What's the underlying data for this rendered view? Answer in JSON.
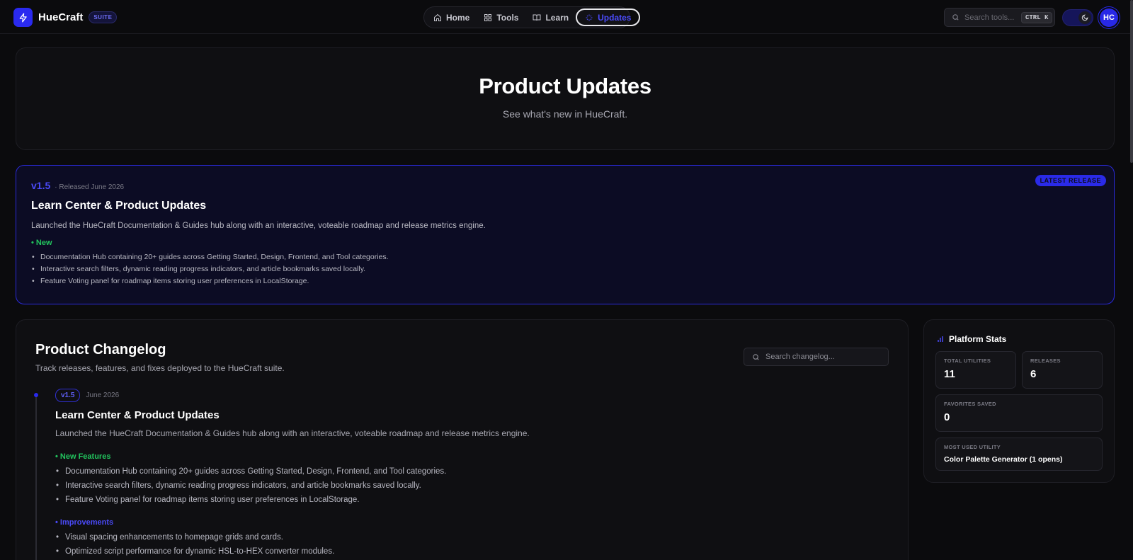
{
  "brand": {
    "name": "HueCraft",
    "badge": "SUITE"
  },
  "nav": {
    "items": [
      {
        "label": "Home",
        "icon": "home-icon"
      },
      {
        "label": "Tools",
        "icon": "grid-icon"
      },
      {
        "label": "Learn",
        "icon": "book-icon"
      },
      {
        "label": "Updates",
        "icon": "sparkle-icon",
        "active": true
      }
    ]
  },
  "search": {
    "placeholder": "Search tools...",
    "shortcut_ctrl": "CTRL",
    "shortcut_key": "K"
  },
  "user": {
    "initials": "HC"
  },
  "hero": {
    "title": "Product Updates",
    "subtitle": "See what's new in HueCraft."
  },
  "latest": {
    "badge": "LATEST RELEASE",
    "version": "v1.5",
    "date": "· Released June 2026",
    "title": "Learn Center & Product Updates",
    "description": "Launched the HueCraft Documentation & Guides hub along with an interactive, voteable roadmap and release metrics engine.",
    "section_label": "• New",
    "items": [
      "Documentation Hub containing 20+ guides across Getting Started, Design, Frontend, and Tool categories.",
      "Interactive search filters, dynamic reading progress indicators, and article bookmarks saved locally.",
      "Feature Voting panel for roadmap items storing user preferences in LocalStorage."
    ]
  },
  "changelog": {
    "title": "Product Changelog",
    "subtitle": "Track releases, features, and fixes deployed to the HueCraft suite.",
    "search_placeholder": "Search changelog...",
    "entry": {
      "version": "v1.5",
      "date": "June 2026",
      "title": "Learn Center & Product Updates",
      "description": "Launched the HueCraft Documentation & Guides hub along with an interactive, voteable roadmap and release metrics engine.",
      "new_label": "• New Features",
      "new_items": [
        "Documentation Hub containing 20+ guides across Getting Started, Design, Frontend, and Tool categories.",
        "Interactive search filters, dynamic reading progress indicators, and article bookmarks saved locally.",
        "Feature Voting panel for roadmap items storing user preferences in LocalStorage."
      ],
      "improve_label": "• Improvements",
      "improve_items": [
        "Visual spacing enhancements to homepage grids and cards.",
        "Optimized script performance for dynamic HSL-to-HEX converter modules."
      ]
    }
  },
  "stats": {
    "title": "Platform Stats",
    "total_utilities_label": "TOTAL UTILITIES",
    "total_utilities": "11",
    "releases_label": "RELEASES",
    "releases": "6",
    "favorites_label": "FAVORITES SAVED",
    "favorites": "0",
    "most_used_label": "MOST USED UTILITY",
    "most_used": "Color Palette Generator (1 opens)"
  },
  "colors": {
    "accent": "#2a2af0",
    "green": "#22c55e",
    "background": "#0b0b0d"
  }
}
